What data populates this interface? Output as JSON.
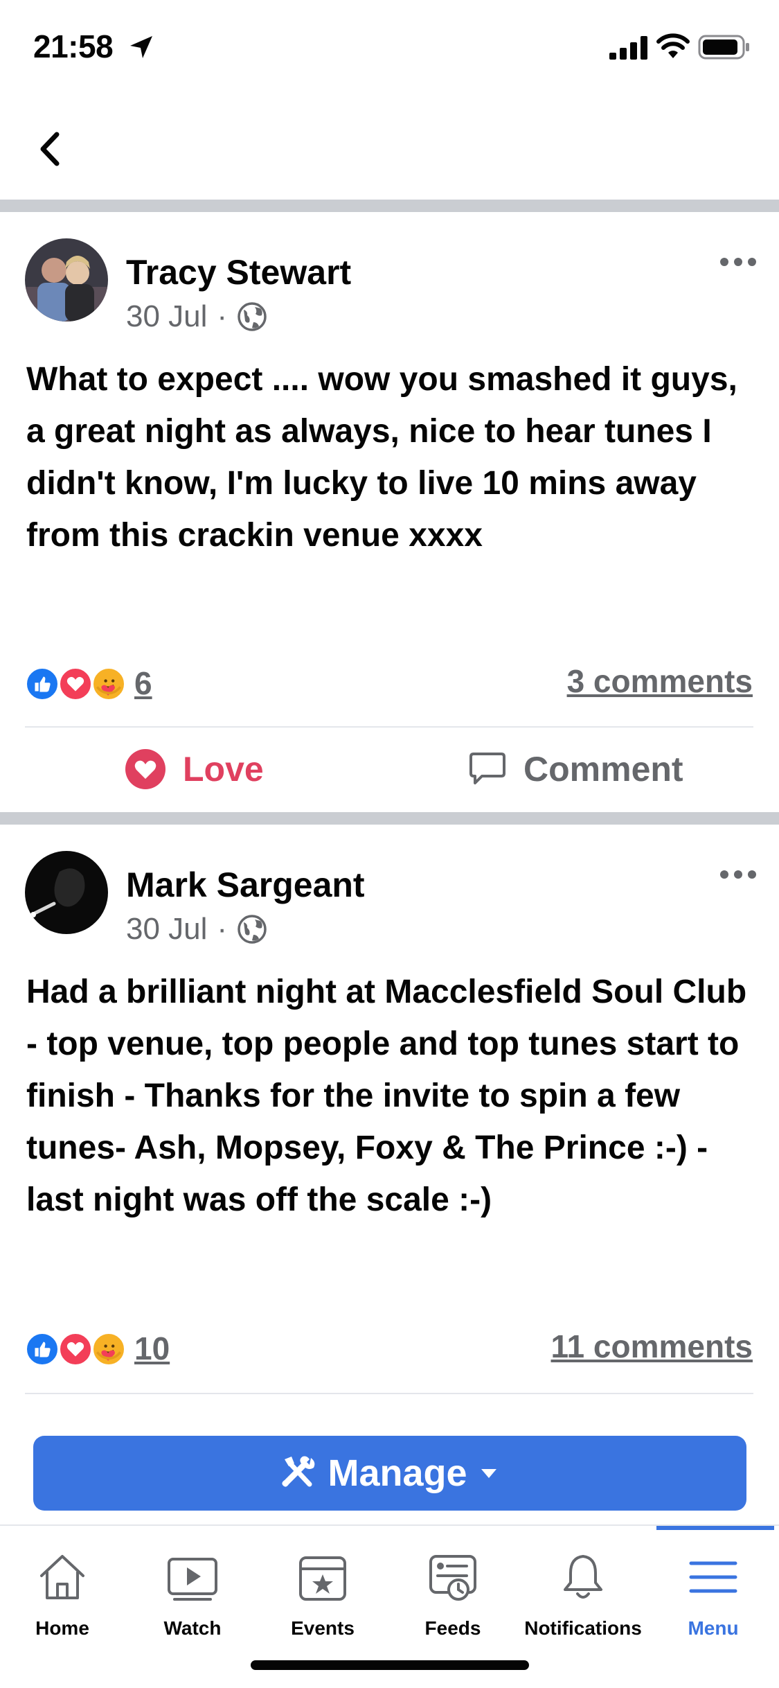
{
  "status_bar": {
    "time": "21:58"
  },
  "posts": [
    {
      "author": "Tracy Stewart",
      "date": "30 Jul",
      "separator": "·",
      "text": "What to expect .... wow you smashed it guys, a great night as always, nice to hear tunes I didn't know, I'm lucky to live 10 mins away from this crackin venue xxxx",
      "reaction_count": "6",
      "comments": "3 comments",
      "actions": {
        "love": "Love",
        "comment": "Comment"
      }
    },
    {
      "author": "Mark Sargeant",
      "date": "30 Jul",
      "separator": "·",
      "text": "Had a brilliant night at Macclesfield Soul Club - top venue, top people and top tunes start to finish - Thanks for the invite to spin a few tunes- Ash, Mopsey, Foxy & The Prince :-)  - last night was off the scale :-)",
      "reaction_count": "10",
      "comments": "11 comments"
    }
  ],
  "manage": {
    "label": "Manage"
  },
  "tabs": [
    {
      "label": "Home",
      "icon": "home-icon"
    },
    {
      "label": "Watch",
      "icon": "watch-icon"
    },
    {
      "label": "Events",
      "icon": "events-icon"
    },
    {
      "label": "Feeds",
      "icon": "feeds-icon"
    },
    {
      "label": "Notifications",
      "icon": "bell-icon"
    },
    {
      "label": "Menu",
      "icon": "menu-icon"
    }
  ],
  "colors": {
    "accent": "#3a74e0",
    "love": "#e0405f",
    "muted": "#65676b",
    "divider": "#cacdd2"
  }
}
